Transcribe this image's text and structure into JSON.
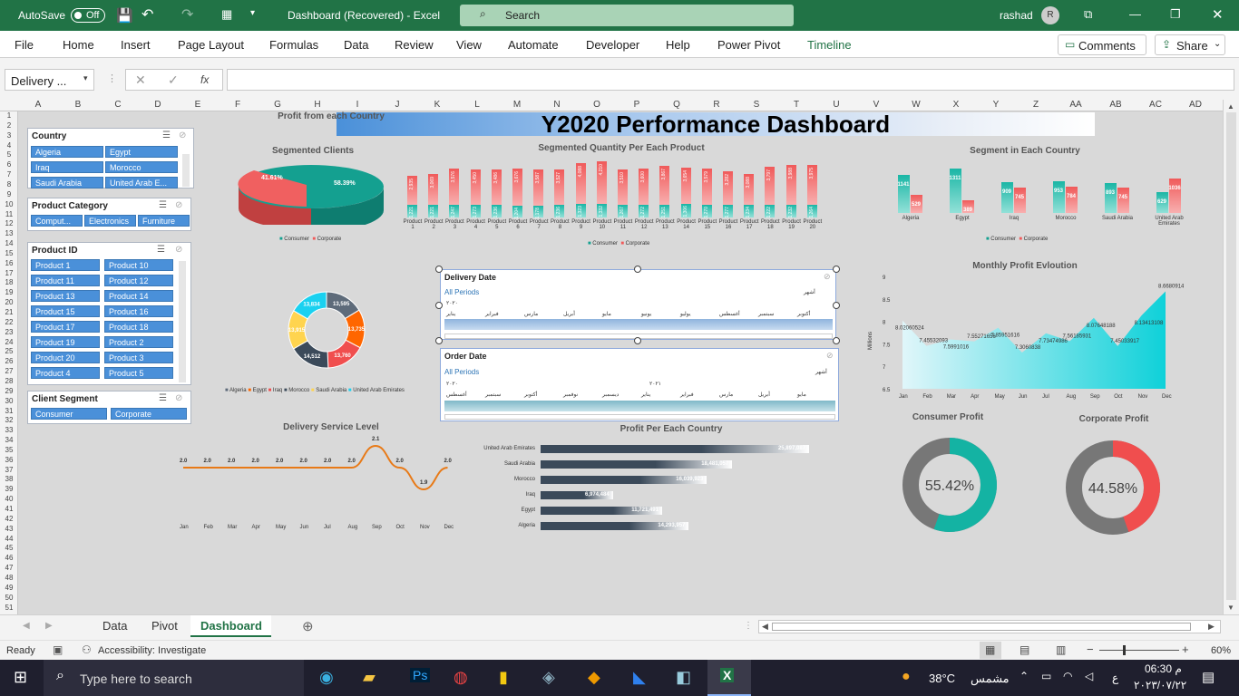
{
  "titlebar": {
    "autosave": "AutoSave",
    "toggle": "Off",
    "doc_title": "Dashboard (Recovered) - Excel",
    "search": "Search",
    "user": "rashad",
    "avatar": "R"
  },
  "ribbon": {
    "tabs": [
      "File",
      "Home",
      "Insert",
      "Page Layout",
      "Formulas",
      "Data",
      "Review",
      "View",
      "Automate",
      "Developer",
      "Help",
      "Power Pivot",
      "Timeline"
    ],
    "comments": "Comments",
    "share": "Share"
  },
  "formula_bar": {
    "name_box": "Delivery ...",
    "fx": "fx",
    "value": ""
  },
  "columns": [
    "A",
    "B",
    "C",
    "D",
    "E",
    "F",
    "G",
    "H",
    "I",
    "J",
    "K",
    "L",
    "M",
    "N",
    "O",
    "P",
    "Q",
    "R",
    "S",
    "T",
    "U",
    "V",
    "W",
    "X",
    "Y",
    "Z",
    "AA",
    "AB",
    "AC",
    "AD"
  ],
  "rows": [
    "1",
    "2",
    "3",
    "4",
    "5",
    "6",
    "7",
    "8",
    "9",
    "10",
    "11",
    "12",
    "13",
    "14",
    "15",
    "16",
    "17",
    "18",
    "19",
    "20",
    "21",
    "22",
    "23",
    "24",
    "25",
    "26",
    "27",
    "28",
    "29",
    "30",
    "31",
    "32",
    "33",
    "34",
    "35",
    "36",
    "37",
    "38",
    "39",
    "40",
    "41",
    "42",
    "43",
    "44",
    "45",
    "46",
    "47",
    "48",
    "49",
    "50",
    "51"
  ],
  "dashboard": {
    "title": "Y2020 Performance Dashboard",
    "slicers": {
      "country": {
        "title": "Country",
        "items": [
          "Algeria",
          "Egypt",
          "Iraq",
          "Morocco",
          "Saudi Arabia",
          "United Arab E..."
        ]
      },
      "category": {
        "title": "Product Category",
        "items": [
          "Comput...",
          "Electronics",
          "Furniture"
        ]
      },
      "product": {
        "title": "Product ID",
        "items": [
          "Product 1",
          "Product 10",
          "Product 11",
          "Product 12",
          "Product 13",
          "Product 14",
          "Product 15",
          "Product 16",
          "Product 17",
          "Product 18",
          "Product 19",
          "Product 2",
          "Product 20",
          "Product 3",
          "Product 4",
          "Product 5"
        ]
      },
      "segment": {
        "title": "Client Segment",
        "items": [
          "Consumer",
          "Corporate"
        ]
      }
    },
    "seg_clients": {
      "title": "Segmented Clients",
      "corporate": "41.61%",
      "consumer": "58.39%",
      "legend": [
        "Consumer",
        "Corporate"
      ]
    },
    "seg_qty": {
      "title": "Segmented Quantity Per Each Product",
      "products": [
        "Product 1",
        "Product 2",
        "Product 3",
        "Product 4",
        "Product 5",
        "Product 6",
        "Product 7",
        "Product 8",
        "Product 9",
        "Product 10",
        "Product 11",
        "Product 12",
        "Product 13",
        "Product 14",
        "Product 15",
        "Product 16",
        "Product 17",
        "Product 18",
        "Product 19",
        "Product 20"
      ],
      "corporate": [
        "2,935",
        "3,069",
        "3,576",
        "3,450",
        "3,486",
        "3,676",
        "3,587",
        "3,527",
        "4,088",
        "4,210",
        "3,510",
        "3,600",
        "3,867",
        "3,654",
        "3,579",
        "3,282",
        "3,088",
        "3,797",
        "3,988",
        "3,975"
      ],
      "consumer": [
        "1,221",
        "1,221",
        "1,247",
        "1,273",
        "1,236",
        "1,204",
        "1,178",
        "1,236",
        "1,323",
        "1,332",
        "1,267",
        "1,272",
        "1,251",
        "1,306",
        "1,270",
        "1,277",
        "1,234",
        "1,222",
        "1,232",
        "1,264"
      ],
      "legend": [
        "Consumer",
        "Corporate"
      ]
    },
    "seg_country": {
      "title": "Segment in Each Country",
      "countries": [
        "Algeria",
        "Egypt",
        "Iraq",
        "Morocco",
        "Saudi Arabia",
        "United Arab Emirates"
      ],
      "consumer": [
        "1141",
        "1311",
        "909",
        "953",
        "893",
        "629"
      ],
      "corporate": [
        "529",
        "389",
        "745",
        "784",
        "745",
        "1036"
      ],
      "legend": [
        "Consumer",
        "Corporate"
      ]
    },
    "profit_country_pie": {
      "title": "Profit from each Country",
      "labels": [
        "13,595",
        "13,735",
        "13,760",
        "14,512",
        "13,915",
        "13,834"
      ],
      "legend": [
        "Algeria",
        "Egypt",
        "Iraq",
        "Morocco",
        "Saudi Arabia",
        "United Arab Emirates"
      ]
    },
    "delivery_timeline": {
      "title": "Delivery Date",
      "periods": "All Periods",
      "unit": "أشهر",
      "year": "٢٠٢٠",
      "months": [
        "يناير",
        "فبراير",
        "مارس",
        "أبريل",
        "مايو",
        "يونيو",
        "يوليو",
        "أغسطس",
        "سبتمبر",
        "أكتوبر"
      ]
    },
    "order_timeline": {
      "title": "Order Date",
      "periods": "All Periods",
      "unit": "أشهر",
      "year1": "٢٠٢٠",
      "year2": "٢٠٢١",
      "months": [
        "أغسطس",
        "سبتمبر",
        "أكتوبر",
        "نوفمبر",
        "ديسمبر",
        "يناير",
        "فبراير",
        "مارس",
        "أبريل",
        "مايو"
      ]
    },
    "monthly_profit": {
      "title": "Monthly Profit Evloution",
      "ylabel": "Millions",
      "yticks": [
        "9",
        "8.5",
        "8",
        "7.5",
        "7",
        "6.5"
      ],
      "months": [
        "Jan",
        "Feb",
        "Mar",
        "Apr",
        "May",
        "Jun",
        "Jul",
        "Aug",
        "Sep",
        "Oct",
        "Nov",
        "Dec"
      ],
      "values": [
        "8.02060524",
        "7.45532093",
        "7.5991016",
        "7.55271656",
        "7.85951616",
        "7.3060838",
        "7.73474986",
        "7.56185931",
        "8.07648188",
        "7.45033917",
        "8.13413108",
        "8.66809146"
      ]
    },
    "delivery_service": {
      "title": "Delivery Service Level",
      "months": [
        "Jan",
        "Feb",
        "Mar",
        "Apr",
        "May",
        "Jun",
        "Jul",
        "Aug",
        "Sep",
        "Oct",
        "Nov",
        "Dec"
      ],
      "values": [
        "2.0",
        "2.0",
        "2.0",
        "2.0",
        "2.0",
        "2.0",
        "2.0",
        "2.0",
        "2.1",
        "2.0",
        "1.9",
        "2.0"
      ]
    },
    "profit_per_country": {
      "title": "Profit Per Each Country",
      "countries": [
        "United Arab Emirates",
        "Saudi Arabia",
        "Morocco",
        "Iraq",
        "Egypt",
        "Algeria"
      ],
      "values": [
        "25,897,087",
        "18,481,057",
        "16,039,923",
        "6,974,484",
        "11,721,491",
        "14,293,957"
      ]
    },
    "consumer_profit": {
      "title": "Consumer Profit",
      "value": "55.42%",
      "fraction": 0.5542,
      "color": "#14b3a3"
    },
    "corporate_profit": {
      "title": "Corporate Profit",
      "value": "44.58%",
      "fraction": 0.4458,
      "color": "#f04e4e"
    }
  },
  "sheet_tabs": [
    "Data",
    "Pivot",
    "Dashboard"
  ],
  "status": {
    "ready": "Ready",
    "accessibility": "Accessibility: Investigate",
    "zoom": "60%"
  },
  "taskbar": {
    "search": "Type here to search",
    "temp": "38°C",
    "weather": "مشمس",
    "time": "06:30 م",
    "date": "٢٠٢٣/٠٧/٢٢",
    "lang": "ع"
  }
}
